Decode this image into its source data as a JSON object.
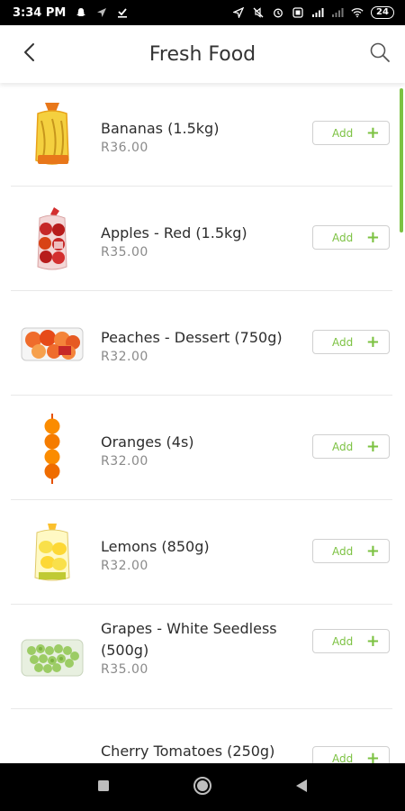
{
  "status_bar": {
    "time": "3:34 PM",
    "battery": "24",
    "icons_left": [
      "snapchat-icon",
      "navigation-arrow-icon",
      "download-done-icon"
    ],
    "icons_right": [
      "location-icon",
      "mute-icon",
      "alarm-icon",
      "data-icon",
      "signal-icon",
      "signal-weak-icon",
      "wifi-icon"
    ]
  },
  "header": {
    "title": "Fresh Food",
    "back_icon": "chevron-left-icon",
    "search_icon": "search-icon"
  },
  "colors": {
    "accent": "#7cc242",
    "price": "#8a8a8a",
    "divider": "#e8e8e8"
  },
  "products": [
    {
      "name": "Bananas (1.5kg)",
      "price": "R36.00",
      "add_label": "Add",
      "image": "bananas-bag-image"
    },
    {
      "name": "Apples - Red (1.5kg)",
      "price": "R35.00",
      "add_label": "Add",
      "image": "red-apples-bag-image"
    },
    {
      "name": "Peaches - Dessert (750g)",
      "price": "R32.00",
      "add_label": "Add",
      "image": "peaches-punnet-image"
    },
    {
      "name": "Oranges (4s)",
      "price": "R32.00",
      "add_label": "Add",
      "image": "oranges-net-image"
    },
    {
      "name": "Lemons (850g)",
      "price": "R32.00",
      "add_label": "Add",
      "image": "lemons-bag-image"
    },
    {
      "name": "Grapes - White Seedless (500g)",
      "price": "R35.00",
      "add_label": "Add",
      "image": "white-grapes-punnet-image"
    },
    {
      "name": "Cherry Tomatoes (250g)",
      "price": "",
      "add_label": "Add",
      "image": "cherry-tomatoes-punnet-image"
    }
  ],
  "nav_bar": [
    "recent-apps-icon",
    "home-icon",
    "back-icon"
  ]
}
